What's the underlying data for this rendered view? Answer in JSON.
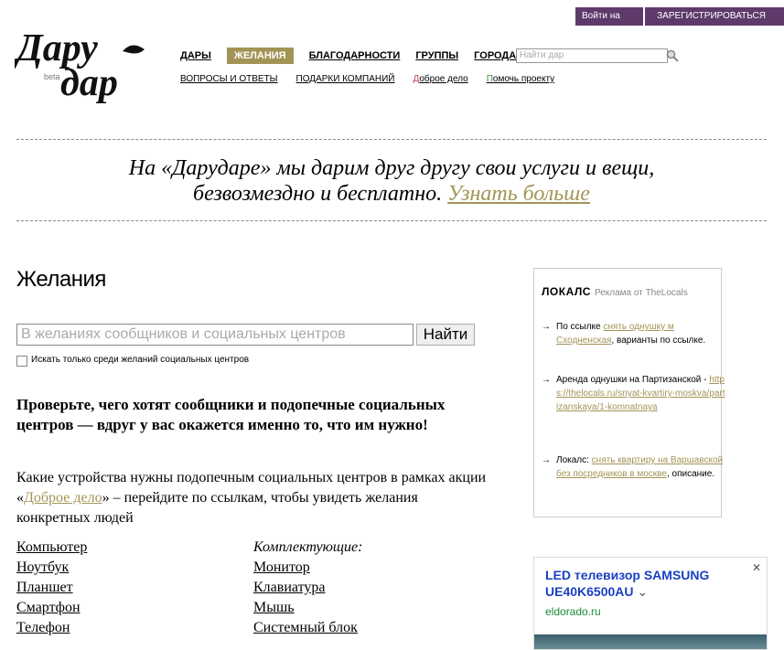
{
  "auth": {
    "login": "Войти на сайт",
    "register": "ЗАРЕГИСТРИРОВАТЬСЯ"
  },
  "logo": {
    "line1": "Дару",
    "line2": "дар",
    "badge": "beta"
  },
  "nav": {
    "main": [
      "ДАРЫ",
      "ЖЕЛАНИЯ",
      "БЛАГОДАРНОСТИ",
      "ГРУППЫ",
      "ГОРОДА"
    ],
    "active": "ЖЕЛАНИЯ",
    "search_placeholder": "Найти дар",
    "secondary": [
      "ВОПРОСЫ И ОТВЕТЫ",
      "ПОДАРКИ КОМПАНИЙ"
    ],
    "good_deed_first": "Д",
    "good_deed_rest": "оброе дело",
    "help_first": "П",
    "help_rest": "омочь проекту"
  },
  "banner": {
    "line1": "На «Дарударе» мы дарим друг другу свои услуги и вещи,",
    "line2": "безвозмездно и бесплатно.",
    "more": "Узнать больше"
  },
  "page": {
    "title": "Желания",
    "search_placeholder": "В желаниях сообщников и социальных центров",
    "search_button": "Найти",
    "checkbox_label": "Искать только среди желаний социальных центров",
    "lead": "Проверьте, чего хотят сообщники и подопечные социальных центров — вдруг у вас окажется именно то, что им нужно!",
    "para_before": "Какие устройства нужны подопечным социальных центров в рамках акции «",
    "para_link": "Доброе дело",
    "para_after": "» – перейдите по ссылкам, чтобы увидеть желания конкретных людей",
    "devices": [
      "Компьютер",
      "Ноутбук",
      "Планшет",
      "Смартфон",
      "Телефон"
    ],
    "components_caption": "Комплектующие:",
    "components": [
      "Монитор",
      "Клавиатура",
      "Мышь",
      "Системный блок"
    ]
  },
  "ad_locals": {
    "brand": "ЛОКАЛС",
    "tag": "Реклама от TheLocals",
    "items": [
      {
        "before": "По ссылке ",
        "link": "снять однушку м Сходненская",
        "after": ", варианты по ссылке."
      },
      {
        "before": "Аренда однушки на Партизанской - ",
        "link": "https://thelocals.ru/snyat-kvartiry-moskva/partizanskaya/1-komnatnaya",
        "after": ""
      },
      {
        "before": "Локалс: ",
        "link": "снять квартиру на Варшавской без посредников в москве",
        "after": ", описание."
      }
    ]
  },
  "ad_tv": {
    "title": "LED телевизор SAMSUNG UE40K6500AU",
    "url": "eldorado.ru"
  },
  "colors": {
    "accent": "#a39456",
    "auth": "#5e3a6b",
    "ad_title": "#1a3fc4",
    "ad_url": "#1a8a3a"
  }
}
